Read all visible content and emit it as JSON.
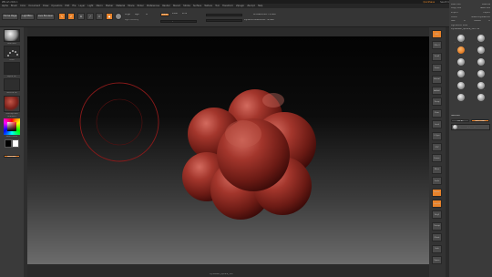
{
  "window": {
    "title": "ZBrush 2021.1",
    "quicksave": "QuickSave",
    "default_ui": "Default ZScript",
    "menus_label": "Menus",
    "see_through": "See-through 0"
  },
  "menubar": {
    "items": [
      "Alpha",
      "Brush",
      "Color",
      "Document",
      "Draw",
      "Dynamics",
      "Edit",
      "File",
      "Layer",
      "Light",
      "Macro",
      "Marker",
      "Material",
      "Movie",
      "Picker",
      "Preferences",
      "Render",
      "Stencil",
      "Stroke",
      "Surface",
      "Texture",
      "Tool",
      "Transform",
      "Zplugin",
      "Zscript",
      "Help"
    ]
  },
  "toolbar": {
    "home_page": "Home Page",
    "lightbox": "LightBox",
    "live_boolean": "Live Boolean",
    "edit_label": "Edit",
    "draw_label": "Draw",
    "move_label": "Move",
    "scale_label": "Scale",
    "rotate_label": "Rotate",
    "mrgb": "Mrgb",
    "rgb": "Rgb",
    "m": "M",
    "zadd": "Zadd",
    "zsub": "Zsub",
    "zcut": "Zcut",
    "rgb_intensity": "Rgb Intensity",
    "z_intensity": "Z Intensity 25",
    "focal_shift": "Focal Shift 0",
    "draw_size": "Draw Size 64",
    "dynamic": "Dynamic",
    "active_points": "ActivePoints: 72,866",
    "total_points": "TotalPoints: 72,866"
  },
  "leftpanel": {
    "brush_label": "Standard",
    "stroke_label": "Dots",
    "alpha_label": "Alpha Off",
    "texture_label": "Texture Off",
    "material_label": "MatCap Red",
    "gradient_label": "Gradient",
    "switch_color": "SwitchColor",
    "alternate": "Alternate"
  },
  "rightstrip": {
    "buttons": [
      "BPR",
      "SPix 3",
      "Scroll",
      "Zoom",
      "Actual",
      "AAHalf",
      "Persp",
      "Floor",
      "Local",
      "L.Sym",
      "XYZ",
      "Frame",
      "Move",
      "Scale",
      "Rotate",
      "Line Fill",
      "PolyF",
      "Transp",
      "Ghost",
      "Solo",
      "Xpose"
    ]
  },
  "rightpanel": {
    "rows": [
      [
        "Load Tool",
        "Save As"
      ],
      [
        "Copy Tool",
        "Paste Tool"
      ],
      [
        "Import",
        "Export"
      ],
      [
        "Clone",
        "Make PolyMesh3D"
      ],
      [
        "GoZ",
        "All",
        "Visible",
        "R"
      ],
      [
        "Lightbox ▸ Tools"
      ],
      [
        "DynaMesh_Sphere_128. 48"
      ]
    ],
    "tools": [
      "DynaMesh_Sphere",
      "Cylinder3D",
      "PolyMesh3D",
      "SimpleBrush",
      "Sphere3D",
      "Cube3D",
      "Cone3D",
      "Ring3D",
      "SphereInflate",
      "Sphere3D_1",
      "Plane3D",
      "Terrain3D"
    ],
    "subtool_header": "Subtool",
    "subtool_items": [
      "DynaMesh_Sphere_128"
    ],
    "list_all": "List All",
    "new_folder": "New Folder"
  },
  "canvas": {
    "bottom_label": "DynaMesh_Sphere_128"
  },
  "colors": {
    "accent": "#e8822a",
    "mesh": "#8a2a22",
    "mesh_highlight": "#c2544a",
    "brush_ring": "#8a1a1a"
  }
}
